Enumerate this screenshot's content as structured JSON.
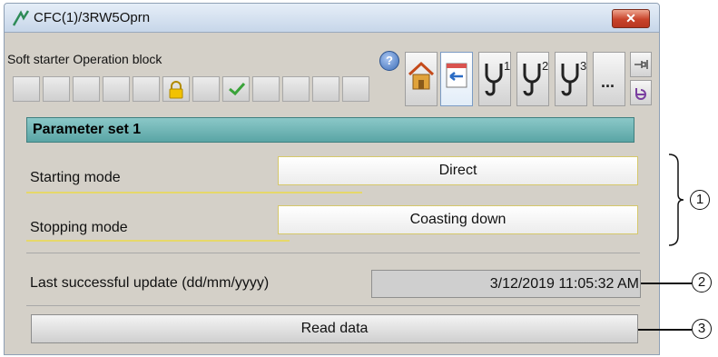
{
  "window": {
    "title": "CFC(1)/3RW5Oprn",
    "close_label": "✕"
  },
  "block": {
    "label": "Soft starter Operation block"
  },
  "toolbar": {
    "help_label": "?",
    "ellipsis_label": "..."
  },
  "parameters": {
    "header": "Parameter set 1",
    "starting_mode_label": "Starting mode",
    "starting_mode_value": "Direct",
    "stopping_mode_label": "Stopping mode",
    "stopping_mode_value": "Coasting down"
  },
  "update": {
    "label": "Last successful update (dd/mm/yyyy)",
    "value": "3/12/2019  11:05:32 AM"
  },
  "read_button": {
    "label": "Read data"
  },
  "callouts": [
    "1",
    "2",
    "3"
  ],
  "icons": {
    "title": "signal-icon",
    "lock": "lock-icon",
    "check": "checkmark-icon",
    "home": "home-icon",
    "list": "standard-view-icon",
    "cable1": "connector-1-icon",
    "cable2": "connector-2-icon",
    "cable3": "connector-3-icon",
    "pin": "pin-icon",
    "back": "return-icon"
  },
  "colors": {
    "header_teal": "#6cb4b4",
    "field_border": "#d6c86a",
    "close_red": "#c8432a"
  }
}
